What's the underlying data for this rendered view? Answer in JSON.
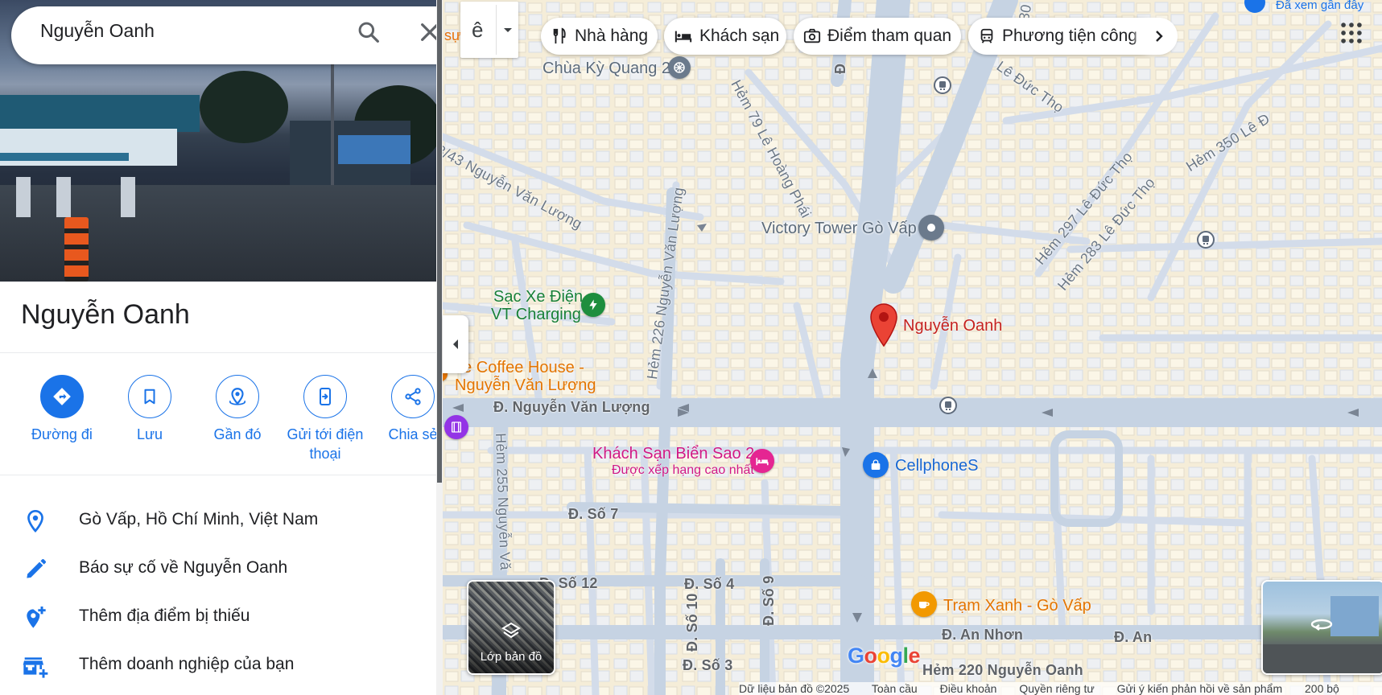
{
  "search": {
    "query": "Nguyễn Oanh"
  },
  "place": {
    "title": "Nguyễn Oanh",
    "photo_alt": "Ảnh đường phố"
  },
  "actions": [
    {
      "label": "Đường đi",
      "icon": "directions-icon"
    },
    {
      "label": "Lưu",
      "icon": "bookmark-icon"
    },
    {
      "label": "Gần đó",
      "icon": "nearby-icon"
    },
    {
      "label": "Gửi tới điện thoại",
      "icon": "send-to-phone-icon"
    },
    {
      "label": "Chia sẻ",
      "icon": "share-icon"
    }
  ],
  "info": [
    {
      "text": "Gò Vấp, Hồ Chí Minh, Việt Nam",
      "icon": "location-pin-icon"
    },
    {
      "text": "Báo sự cố về Nguyễn Oanh",
      "icon": "edit-pencil-icon"
    },
    {
      "text": "Thêm địa điểm bị thiếu",
      "icon": "add-location-icon"
    },
    {
      "text": "Thêm doanh nghiệp của bạn",
      "icon": "add-business-icon"
    }
  ],
  "chips": [
    {
      "label": "Nhà hàng",
      "icon": "restaurant-icon"
    },
    {
      "label": "Khách sạn",
      "icon": "hotel-icon"
    },
    {
      "label": "Điểm tham quan",
      "icon": "camera-icon"
    },
    {
      "label": "Phương tiện công c",
      "icon": "transit-icon"
    }
  ],
  "map": {
    "lang_letter": "ê",
    "left_edge_text": "sự",
    "recent_text": "Đã xem gần đây",
    "layers_label": "Lớp bản đồ",
    "google": "Google",
    "streets": {
      "nguyen_van_luong": "Đ. Nguyễn Văn Lượng",
      "hem43": "3/43 Nguyễn Văn Lượng",
      "hem226": "Hẻm 226 Nguyễn Văn Lượng",
      "hem79": "Hẻm 79 Lê Hoàng Phái",
      "le_duc_tho": "Lê Đức Thọ",
      "hem297": "Hẻm 297 Lê Đức Thọ",
      "hem283": "Hẻm 283 Lê Đức Thọ",
      "hem350": "Hẻm 350 Lê Đ",
      "hem255": "Hẻm 255 Nguyễn Vă",
      "so7": "Đ. Số 7",
      "so12": "Đ. Số 12",
      "so4": "Đ. Số 4",
      "so10": "Đ. Số 10",
      "so9": "Đ. Số 9",
      "so3": "Đ. Số 3",
      "an_nhon": "Đ. An Nhơn",
      "an_nhon2": "Đ. An",
      "hem220": "Hẻm 220 Nguyễn Oanh",
      "d_top": "Đ",
      "num_top": "30"
    },
    "pois": {
      "chua": "Chùa Kỳ Quang 2",
      "victory": "Victory Tower Gò Vấp",
      "sac_xe_1": "Sạc Xe Điện",
      "sac_xe_2": "VT Charging",
      "coffee_1": "he Coffee House -",
      "coffee_2": "Nguyễn Văn Lượng",
      "khach_san": "Khách Sạn Biển Sao 2",
      "khach_san_sub": "Được xếp hạng cao nhất",
      "cellphones": "CellphoneS",
      "tram_xanh": "Trạm Xanh - Gò Vấp",
      "selected": "Nguyễn Oanh"
    },
    "footer": [
      "Dữ liệu bản đồ ©2025",
      "Toàn cầu",
      "Điều khoản",
      "Quyền riêng tư",
      "Gửi ý kiến phản hồi về sản phẩm",
      "200 bộ"
    ]
  },
  "colors": {
    "accent": "#1a73e8",
    "pin": "#ea4335",
    "map_bg": "#f8f1df",
    "road": "#c6d3e3"
  }
}
